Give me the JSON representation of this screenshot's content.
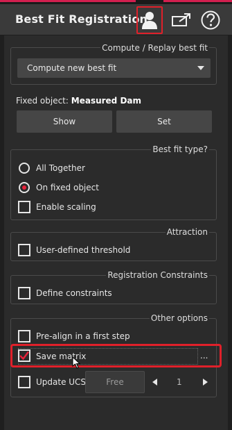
{
  "header": {
    "title": "Best Fit Registration",
    "icons": [
      "user-icon",
      "share-icon",
      "help-icon"
    ]
  },
  "compute_group": {
    "label": "Compute / Replay best fit",
    "dropdown_value": "Compute new best fit"
  },
  "fixed_object": {
    "prefix": "Fixed object:",
    "name": "Measured Dam",
    "show_label": "Show",
    "set_label": "Set"
  },
  "best_fit_type": {
    "label": "Best fit type?",
    "options": [
      {
        "label": "All Together",
        "selected": false
      },
      {
        "label": "On fixed object",
        "selected": true
      }
    ],
    "enable_scaling": {
      "label": "Enable scaling",
      "checked": false
    }
  },
  "attraction": {
    "label": "Attraction",
    "threshold": {
      "label": "User-defined threshold",
      "checked": false
    }
  },
  "constraints": {
    "label": "Registration Constraints",
    "define": {
      "label": "Define constraints",
      "checked": false
    }
  },
  "other_options": {
    "label": "Other options",
    "prealign": {
      "label": "Pre-align in a first step",
      "checked": false
    },
    "save_matrix": {
      "label": "Save matrix",
      "checked": true,
      "browse_label": "..."
    },
    "update_ucs": {
      "label": "Update UCS",
      "checked": false,
      "free_label": "Free",
      "page": "1"
    }
  },
  "colors": {
    "accent": "#e8213a",
    "highlight": "#e0202a",
    "background": "#2b2b2b",
    "header": "#3a3a3a"
  }
}
